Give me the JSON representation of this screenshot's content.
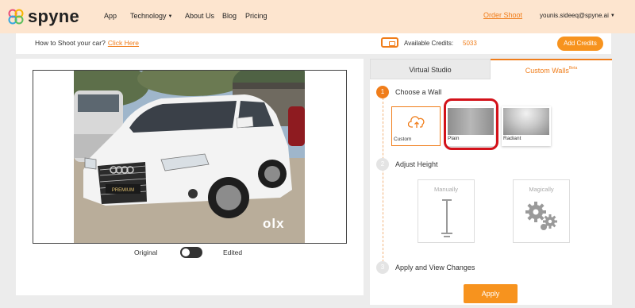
{
  "brand": {
    "name": "spyne"
  },
  "nav": {
    "app": "App",
    "technology": "Technology",
    "about": "About Us",
    "blog": "Blog",
    "pricing": "Pricing",
    "order_shoot": "Order Shoot",
    "user_email": "younis.sideeq@spyne.ai"
  },
  "info_bar": {
    "howto_text": "How to Shoot your car?",
    "howto_link": "Click Here",
    "credits_label": "Available Credits:",
    "credits_value": "5033",
    "add_credits": "Add Credits"
  },
  "preview": {
    "toggle_left": "Original",
    "toggle_right": "Edited",
    "toggle_on": false,
    "watermark": "olx"
  },
  "tabs": {
    "virtual_studio": "Virtual Studio",
    "custom_walls": "Custom Walls",
    "custom_walls_badge": "Beta"
  },
  "steps": [
    {
      "number": "1",
      "title": "Choose a Wall"
    },
    {
      "number": "2",
      "title": "Adjust Height"
    },
    {
      "number": "3",
      "title": "Apply and View Changes"
    }
  ],
  "walls": [
    {
      "label": "Custom",
      "icon": "cloud-upload-icon"
    },
    {
      "label": "Plain",
      "selected_highlight": true
    },
    {
      "label": "Radiant"
    }
  ],
  "height_options": {
    "manual": "Manually",
    "magic": "Magically"
  },
  "apply_label": "Apply",
  "colors": {
    "accent": "#f07d1a",
    "nav_bg": "#fde5cf",
    "highlight": "#d3121a"
  }
}
